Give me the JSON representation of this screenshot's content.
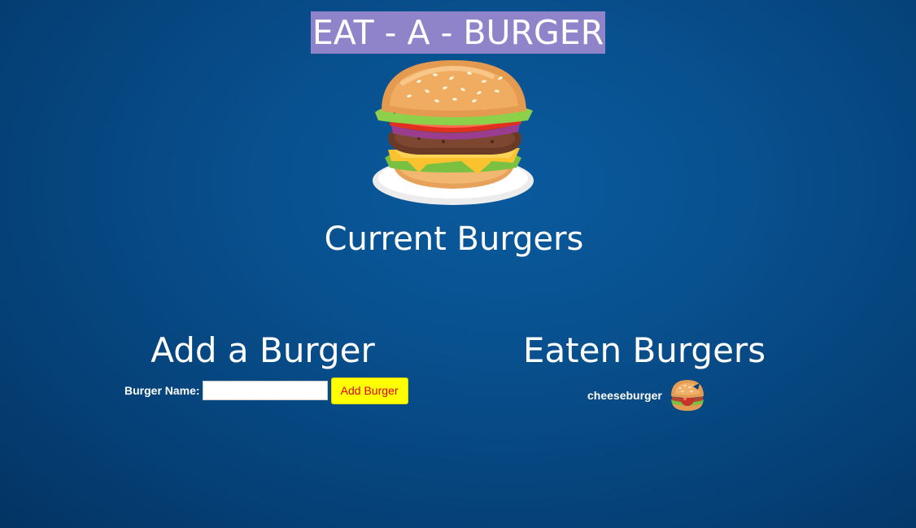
{
  "app": {
    "title": "EAT - A - BURGER"
  },
  "hero": {
    "icon": "burger-illustration"
  },
  "sections": {
    "current": {
      "title": "Current Burgers",
      "items": []
    },
    "add": {
      "title": "Add a Burger",
      "label": "Burger Name:",
      "input_value": "",
      "input_placeholder": "",
      "button_label": "Add Burger"
    },
    "eaten": {
      "title": "Eaten Burgers",
      "items": [
        {
          "name": "cheeseburger",
          "icon": "eaten-burger-icon"
        }
      ]
    }
  },
  "colors": {
    "background": "#08508e",
    "title_highlight": "#8f84c9",
    "button_bg": "#ffff00",
    "button_text": "#e0001b"
  }
}
